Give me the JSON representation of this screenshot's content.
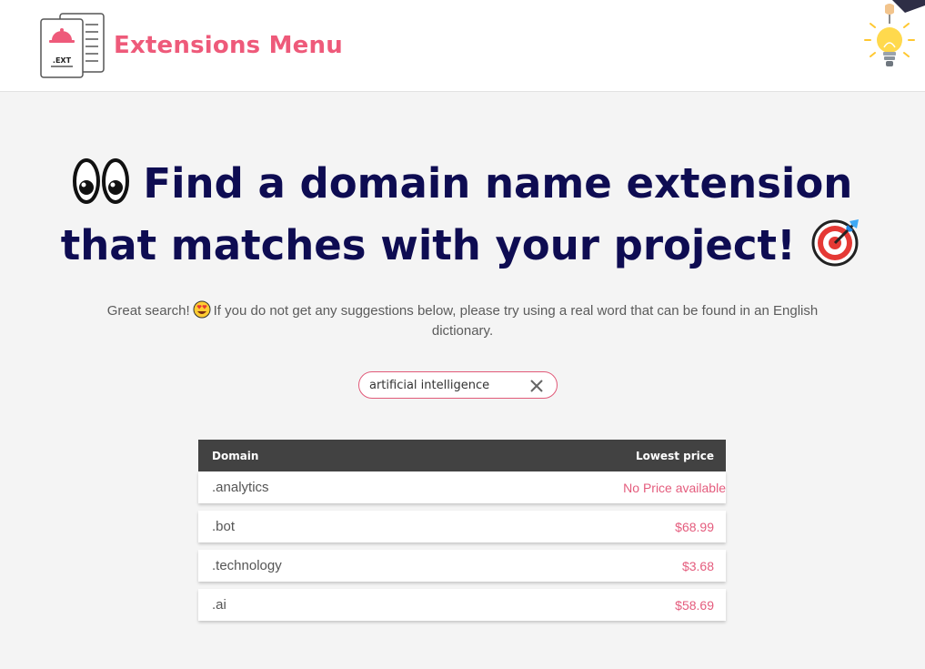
{
  "header": {
    "brand": "Extensions Menu",
    "logo_text": ".EXT",
    "logo_icon": "document-with-cloche-icon",
    "decoration_icon": "lightbulb-hand-icon"
  },
  "hero": {
    "line1": "Find a domain name extension",
    "line2": "that matches with your project!",
    "leading_icon": "eyes-icon",
    "trailing_icon": "bullseye-icon"
  },
  "message": {
    "before": "Great search!",
    "after": "If you do not get any suggestions below, please try using a real word that can be found in an English dictionary.",
    "icon": "heart-eyes-icon"
  },
  "search": {
    "value": "artificial intelligence",
    "clear_icon": "close-icon"
  },
  "table": {
    "columns": [
      "Domain",
      "Lowest price"
    ],
    "rows": [
      {
        "domain": ".analytics",
        "price": "No Price available"
      },
      {
        "domain": ".bot",
        "price": "$68.99"
      },
      {
        "domain": ".technology",
        "price": "$3.68"
      },
      {
        "domain": ".ai",
        "price": "$58.69"
      }
    ]
  },
  "colors": {
    "brand": "#ee5a7a",
    "heading": "#0e0c52",
    "table_header": "#424242",
    "page_background": "#f4f4f4"
  }
}
